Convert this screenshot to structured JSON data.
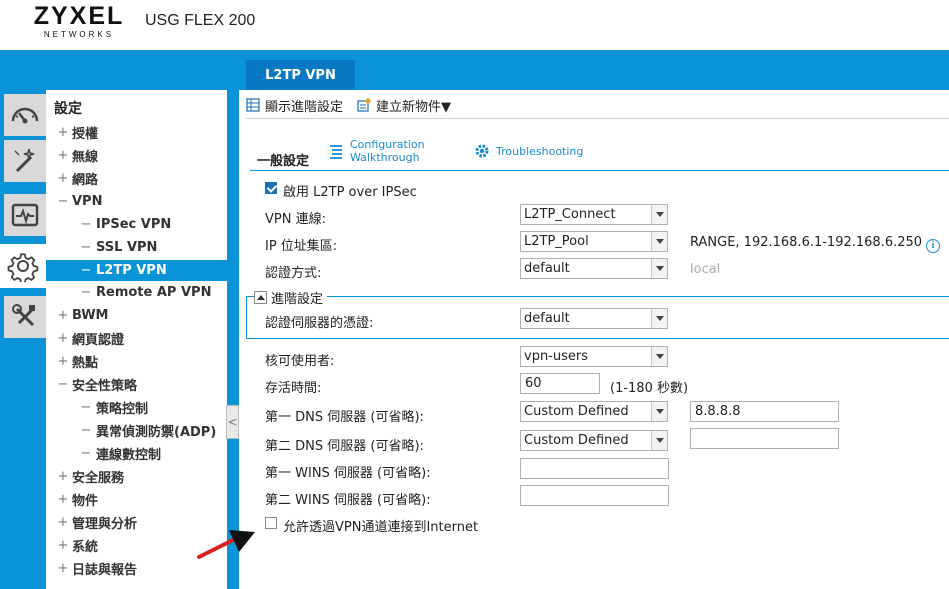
{
  "header": {
    "brand": "ZYXEL",
    "brand_sub": "NETWORKS",
    "model": "USG FLEX 200",
    "active_tab": "L2TP VPN"
  },
  "rail": {
    "icons": [
      "dashboard-icon",
      "magic-wand-icon",
      "monitor-icon",
      "gear-icon",
      "tools-icon"
    ],
    "active": "gear-icon"
  },
  "nav": {
    "title": "設定",
    "items": [
      {
        "sym": "+",
        "label": "授權"
      },
      {
        "sym": "+",
        "label": "無線"
      },
      {
        "sym": "+",
        "label": "網路"
      },
      {
        "sym": "−",
        "label": "VPN"
      },
      {
        "sym": "−",
        "label": "IPSec VPN"
      },
      {
        "sym": "−",
        "label": "SSL VPN"
      },
      {
        "sym": "−",
        "label": "L2TP VPN"
      },
      {
        "sym": "−",
        "label": "Remote AP VPN"
      },
      {
        "sym": "+",
        "label": "BWM"
      },
      {
        "sym": "+",
        "label": "網頁認證"
      },
      {
        "sym": "+",
        "label": "熱點"
      },
      {
        "sym": "−",
        "label": "安全性策略"
      },
      {
        "sym": "−",
        "label": "策略控制"
      },
      {
        "sym": "−",
        "label": "異常偵測防禦(ADP)"
      },
      {
        "sym": "−",
        "label": "連線數控制"
      },
      {
        "sym": "+",
        "label": "安全服務"
      },
      {
        "sym": "+",
        "label": "物件"
      },
      {
        "sym": "+",
        "label": "管理與分析"
      },
      {
        "sym": "+",
        "label": "系統"
      },
      {
        "sym": "+",
        "label": "日誌與報告"
      }
    ],
    "collapse_glyph": "<"
  },
  "toolbar": {
    "show_advanced": "顯示進階設定",
    "create_object": "建立新物件▼"
  },
  "general": {
    "title": "一般設定",
    "config_walkthrough_line1": "Configuration",
    "config_walkthrough_line2": "Walkthrough",
    "troubleshooting": "Troubleshooting",
    "enable_label": "啟用 L2TP over IPSec",
    "enable_checked": true,
    "vpn_conn_label": "VPN 連線:",
    "vpn_conn_value": "L2TP_Connect",
    "ip_pool_label": "IP 位址集區:",
    "ip_pool_value": "L2TP_Pool",
    "ip_pool_range": "RANGE, 192.168.6.1-192.168.6.250",
    "info_glyph": "i",
    "auth_label": "認證方式:",
    "auth_value": "default",
    "auth_note": "local"
  },
  "advanced": {
    "title": "進階設定",
    "cert_label": "認證伺服器的憑證:",
    "cert_value": "default"
  },
  "users": {
    "allowed_label": "核可使用者:",
    "allowed_value": "vpn-users",
    "keepalive_label": "存活時間:",
    "keepalive_value": "60",
    "keepalive_range": "(1-180 秒數)",
    "dns1_label": "第一 DNS 伺服器 (可省略):",
    "dns1_type": "Custom Defined",
    "dns1_value": "8.8.8.8",
    "dns2_label": "第二 DNS 伺服器 (可省略):",
    "dns2_type": "Custom Defined",
    "dns2_value": "",
    "wins1_label": "第一 WINS 伺服器 (可省略):",
    "wins1_value": "",
    "wins2_label": "第二 WINS 伺服器 (可省略):",
    "wins2_value": "",
    "internet_label": "允許透過VPN通道連接到Internet",
    "internet_checked": false
  },
  "colors": {
    "brand_blue": "#0a93d6",
    "dark_blue_tab": "#0a79c4",
    "link_blue": "#1a8bd0",
    "annotation_red": "#d8201f"
  }
}
